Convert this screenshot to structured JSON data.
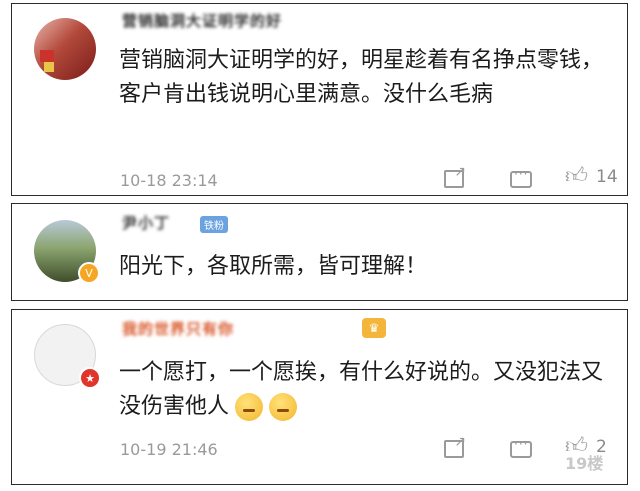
{
  "comments": [
    {
      "username": "营销脑洞大证明学的好",
      "text": "营销脑洞大证明学的好，明星趁着有名挣点零钱，客户肯出钱说明心里满意。没什么毛病",
      "time": "10-18 23:14",
      "likes": "14"
    },
    {
      "username": "尹小丁",
      "tag": "铁粉",
      "text": "阳光下，各取所需，皆可理解！"
    },
    {
      "username": "我的世界只有你",
      "text": "一个愿打，一个愿挨，有什么好说的。又没犯法又没伤害他人",
      "time": "10-19 21:46",
      "likes": "2"
    }
  ],
  "watermark": "19楼"
}
